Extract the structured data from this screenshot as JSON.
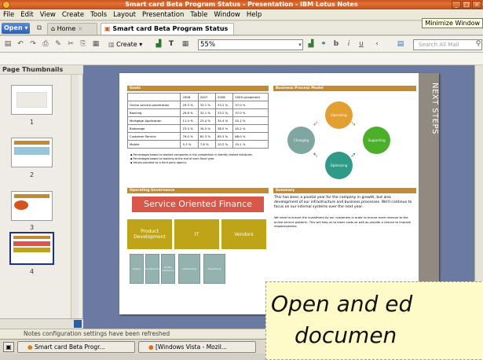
{
  "window": {
    "title": "Smart card Beta Program Status - Presentation - IBM Lotus Notes",
    "tooltip": "Minimize Window",
    "buttons": {
      "minimize": "_",
      "maximize": "□",
      "close": "×"
    }
  },
  "menu": [
    "File",
    "Edit",
    "View",
    "Create",
    "Tools",
    "Layout",
    "Presentation",
    "Table",
    "Window",
    "Help"
  ],
  "tabs": {
    "open_label": "Open",
    "home_label": "Home",
    "doc_label": "Smart card Beta Program Status"
  },
  "toolbar": {
    "create_label": "Create",
    "zoom_value": "55%",
    "search_placeholder": "Search All Mail"
  },
  "left_panel": {
    "title": "Page Thumbnails",
    "pages": [
      "1",
      "2",
      "3",
      "4"
    ],
    "selected_page": "4"
  },
  "slide": {
    "goals_title": "Goals",
    "table_header": [
      "",
      "2006",
      "2007",
      "2008",
      "2009 (projected)"
    ],
    "table_rows": [
      [
        "Online service penetration",
        "29.3 %",
        "32.1 %",
        "33.2 %",
        "37.0 %"
      ],
      [
        "Banking",
        "29.8 %",
        "32.1 %",
        "33.2 %",
        "37.0 %"
      ],
      [
        "Mortgage Application",
        "11.4 %",
        "23.4 %",
        "34.4 %",
        "45.1 %"
      ],
      [
        "Brokerage",
        "23.5 %",
        "34.5 %",
        "38.5 %",
        "45.2 %"
      ],
      [
        "Customer Service",
        "79.0 %",
        "82.3 %",
        "85.3 %",
        "88.0 %"
      ],
      [
        "Mobile",
        "5.3 %",
        "7.8 %",
        "10.2 %",
        "15.1 %"
      ]
    ],
    "bullets": [
      "Percentages based on banked companies in the competition in identify related industries.",
      "Percentages based on banking at the end of each fiscal year.",
      "Values provided by a third party agency."
    ],
    "bpm_title": "Business Process Model",
    "cycle": [
      "Operating",
      "Supporting",
      "Optimizing",
      "Changing"
    ],
    "org_title": "Operating Governance",
    "sof_label": "Service Oriented Finance",
    "boxes": [
      "Product Development",
      "IT",
      "Vendors"
    ],
    "small_boxes": [
      "Design",
      "Manufacturing",
      "Quality Assurance",
      "Outsourcing",
      "Engineering"
    ],
    "summary_title": "Summary",
    "summary_p1": "This has been a pivotal year for the company in growth, but also development of our infrastructure and business processes. We'll continue to focus on our internal systems over the next year.",
    "summary_p2": "We need to ensure the investment by our customers in order to ensure more revenue to the online service platform. This will help us to lower costs as well as provide a chance to improve responsiveness.",
    "side_label": "NEXT STEPS"
  },
  "status": {
    "message": "Notes configuration settings have been refreshed"
  },
  "taskbar": [
    "Smart card Beta Progr...",
    "[Windows Vista - Mozil..."
  ],
  "banner": {
    "line1": "Open and ed",
    "line2": "documen"
  },
  "colors": {
    "accent": "#c38b2f",
    "title_bar": "#d0602a",
    "canvas": "#6b7aa0",
    "sof": "#d7584a",
    "yellow": "#bfa417"
  }
}
